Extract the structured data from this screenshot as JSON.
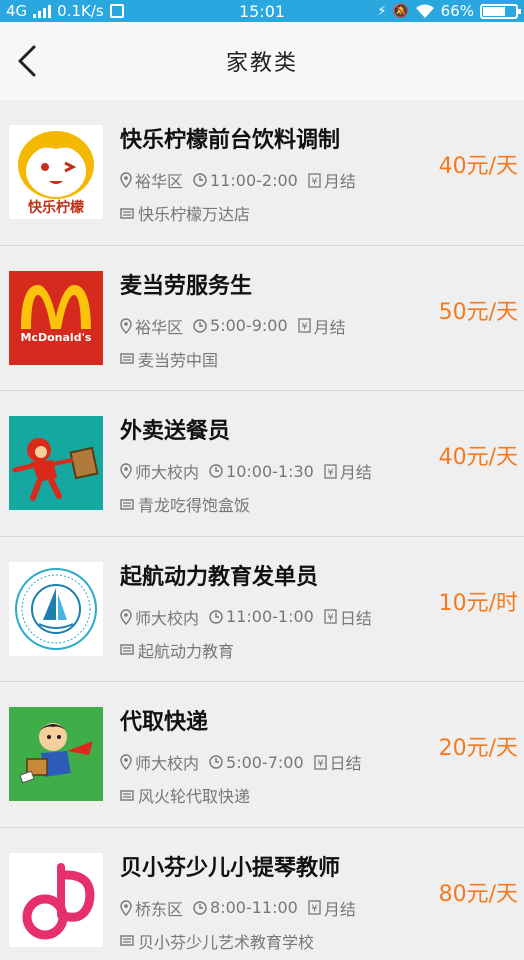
{
  "status_bar": {
    "network": "4G",
    "speed": "0.1K/s",
    "time": "15:01",
    "battery": "66%",
    "battery_level": 0.66,
    "color": "#2ba7e0"
  },
  "header": {
    "title": "家教类",
    "back_icon": "chevron-left-icon"
  },
  "colors": {
    "wage": "#f47a1e",
    "bg": "#efefef"
  },
  "jobs": [
    {
      "title": "快乐柠檬前台饮料调制",
      "district": "裕华区",
      "hours": "11:00-2:00",
      "settlement": "月结",
      "shop": "快乐柠檬万达店",
      "wage": "40元/天",
      "logo_text": "快乐柠檬",
      "logo": "happy-lemon-logo"
    },
    {
      "title": "麦当劳服务生",
      "district": "裕华区",
      "hours": "5:00-9:00",
      "settlement": "月结",
      "shop": "麦当劳中国",
      "wage": "50元/天",
      "logo_text": "McDonald's",
      "logo": "mcdonalds-logo"
    },
    {
      "title": "外卖送餐员",
      "district": "师大校内",
      "hours": "10:00-1:30",
      "settlement": "月结",
      "shop": "青龙吃得饱盒饭",
      "wage": "40元/天",
      "logo": "delivery-hero-logo"
    },
    {
      "title": "起航动力教育发单员",
      "district": "师大校内",
      "hours": "11:00-1:00",
      "settlement": "日结",
      "shop": "起航动力教育",
      "wage": "10元/时",
      "logo": "sailing-education-logo"
    },
    {
      "title": "代取快递",
      "district": "师大校内",
      "hours": "5:00-7:00",
      "settlement": "日结",
      "shop": "风火轮代取快递",
      "wage": "20元/天",
      "logo": "courier-hero-logo"
    },
    {
      "title": "贝小芬少儿小提琴教师",
      "district": "桥东区",
      "hours": "8:00-11:00",
      "settlement": "月结",
      "shop": "贝小芬少儿艺术教育学校",
      "wage": "80元/天",
      "logo": "violin-school-logo"
    }
  ]
}
